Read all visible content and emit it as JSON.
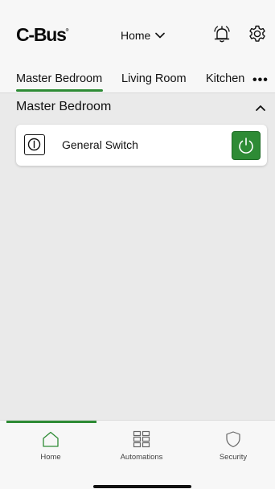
{
  "app": {
    "logo_text": "C-Bus",
    "logo_mark": "®"
  },
  "header": {
    "home_selector": "Home",
    "alarm_icon": "alarm-bell-icon",
    "settings_icon": "gear-icon"
  },
  "tabs": [
    {
      "label": "Master Bedroom",
      "selected": true
    },
    {
      "label": "Living Room",
      "selected": false
    },
    {
      "label": "Kitchen",
      "selected": false
    }
  ],
  "more": "•••",
  "section": {
    "title": "Master Bedroom",
    "expanded": true
  },
  "devices": [
    {
      "label": "General Switch",
      "icon": "switch-icon",
      "state": "on"
    }
  ],
  "bottom_nav": [
    {
      "label": "Home",
      "icon": "home-icon",
      "active": true
    },
    {
      "label": "Automations",
      "icon": "automations-grid-icon",
      "active": false
    },
    {
      "label": "Security",
      "icon": "shield-icon",
      "active": false
    }
  ],
  "colors": {
    "accent": "#2e8b35",
    "background": "#eaeaea",
    "card": "#ffffff"
  }
}
